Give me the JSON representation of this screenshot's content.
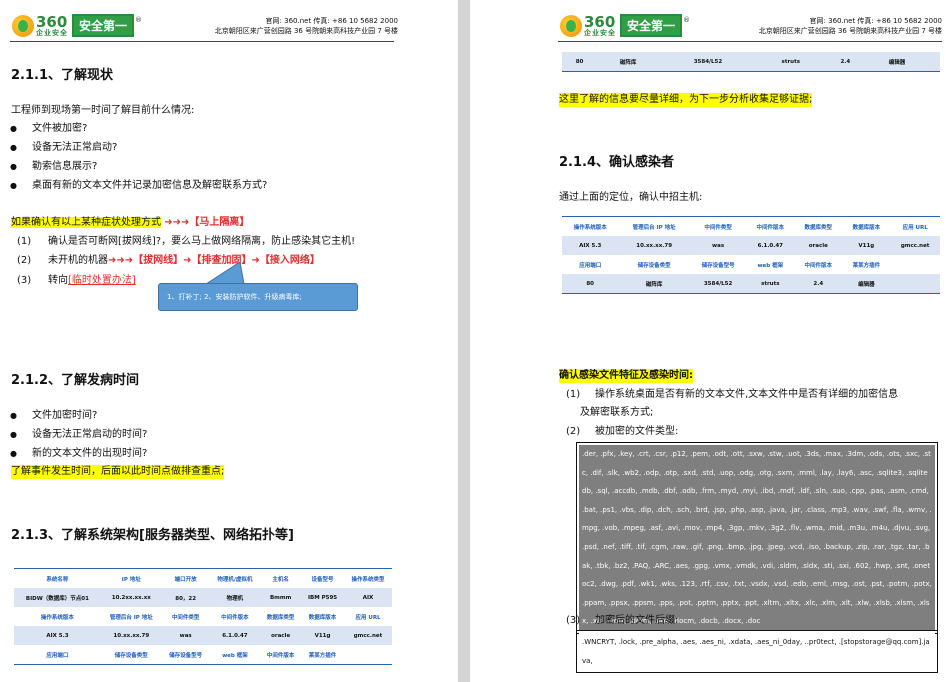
{
  "header": {
    "logo_number": "360",
    "logo_sub": "企业安全",
    "logo_box": "安全第一",
    "registered": "®",
    "line1": "官网: 360.net    传真: +86 10 5682 2000",
    "line2": "北京朝阳区来广营创园路 36 号院朝来高科技产业园 7 号楼"
  },
  "left": {
    "s211_title": "2.1.1、了解现状",
    "intro": "工程师到现场第一时间了解目前什么情况:",
    "bullets1": [
      "文件被加密?",
      "设备无法正常启动?",
      "勒索信息展示?",
      "桌面有新的文本文件并记录加密信息及解密联系方式?"
    ],
    "symptom_text": "如果确认有以上某种症状处理方式",
    "symptom_arrows": "➜➜➜",
    "symptom_action": "【马上隔离】",
    "item1_num": "(1)",
    "item1": "确认是否可断网[拔网线]?，要么马上做网络隔离，防止感染其它主机!",
    "item2_num": "(2)",
    "item2_text": "未开机的机器",
    "item2_red": "➜➜➜【拔网线】➜【排查加固】➜【接入网络】",
    "item3_num": "(3)",
    "item3_text": "转向",
    "item3_link": "[临时处置办法]",
    "callout": "1、打补丁; 2、安装防护软件、升级病毒库;",
    "s212_title": "2.1.2、了解发病时间",
    "bullets2": [
      "文件加密时间?",
      "设备无法正常启动的时间?",
      "新的文本文件的出现时间?"
    ],
    "s212_note": "了解事件发生时间，后面以此时间点做排查重点;",
    "s213_title": "2.1.3、了解系统架构[服务器类型、网络拓扑等]",
    "table": {
      "rows": [
        [
          "系统名称",
          "IP 地址",
          "端口开放",
          "物理机/虚拟机",
          "主机名",
          "设备型号",
          "操作系统类型"
        ],
        [
          "BIDW（数据库）节点01",
          "10.2xx.xx.xx",
          "80，22",
          "物理机",
          "Bmmm",
          "IBM P595",
          "AIX"
        ],
        [
          "操作系统版本",
          "管理后台 IP 地址",
          "中间件类型",
          "中间件版本",
          "数据库类型",
          "数据库版本",
          "应用 URL"
        ],
        [
          "AIX 5.3",
          "10.xx.xx.79",
          "was",
          "6.1.0.47",
          "oracle",
          "V11g",
          "gmcc.net"
        ],
        [
          "应用端口",
          "储存设备类型",
          "储存设备型号",
          "web 框架",
          "中间件版本",
          "莱某方插件",
          ""
        ]
      ]
    }
  },
  "right": {
    "top_row": [
      "80",
      "磁阵库",
      "3584/L52",
      "struts",
      "2.4",
      "编辑器"
    ],
    "note1": "这里了解的信息要尽量详细，为下一步分析收集足够证据;",
    "s214_title": "2.1.4、确认感染者",
    "s214_intro": "通过上面的定位，确认中招主机:",
    "table": {
      "rows": [
        [
          "操作系统版本",
          "管理后台 IP 地址",
          "中间件类型",
          "中间件版本",
          "数据库类型",
          "数据库版本",
          "应用 URL"
        ],
        [
          "AIX 5.3",
          "10.xx.xx.79",
          "was",
          "6.1.0.47",
          "oracle",
          "V11g",
          "gmcc.net"
        ],
        [
          "应用端口",
          "储存设备类型",
          "储存设备型号",
          "web 框架",
          "中间件版本",
          "莱某方插件",
          ""
        ],
        [
          "80",
          "磁阵库",
          "3584/L52",
          "struts",
          "2.4",
          "编辑器",
          ""
        ]
      ]
    },
    "confirm_title": "确认感染文件特征及感染时间:",
    "c1_num": "(1)",
    "c1_line1": "操作系统桌面是否有新的文本文件,文本文件中是否有详细的加密信息",
    "c1_line2": "及解密联系方式;",
    "c2_num": "(2)",
    "c2_text": "被加密的文件类型:",
    "file_types": ".der, .pfx, .key, .crt, .csr, .p12, .pem, .odt, .ott, .sxw, .stw, .uot, .3ds, .max, .3dm, .ods, .ots, .sxc, .stc, .dif, .slk, .wb2, .odp, .otp, .sxd, .std, .uop, .odg, .otg, .sxm, .mml, .lay, .lay6, .asc, .sqlite3, .sqlitedb, .sql, .accdb, .mdb, .dbf, .odb, .frm, .myd, .myi, .ibd, .mdf, .ldf, .sln, .suo, .cpp, .pas, .asm, .cmd, .bat, .ps1, .vbs, .dip, .dch, .sch, .brd, .jsp, .php, .asp, .java, .jar, .class, .mp3, .wav, .swf, .fla, .wmv, .mpg, .vob, .mpeg, .asf, .avi, .mov, .mp4, .3gp, .mkv, .3g2, .flv, .wma, .mid, .m3u, .m4u, .djvu, .svg, .psd, .nef, .tiff, .tif, .cgm, .raw, .gif, .png, .bmp, .jpg, .jpeg, .vcd, .iso, .backup, .zip, .rar, .tgz, .tar, .bak, .tbk, .bz2, .PAQ, .ARC, .aes, .gpg, .vmx, .vmdk, .vdi, .sldm, .sldx, .sti, .sxi, .602, .hwp, .snt, .onetoc2, .dwg, .pdf, .wk1, .wks, .123, .rtf, .csv, .txt, .vsdx, .vsd, .edb, .eml, .msg, .ost, .pst, .potm, .potx, .ppam, .ppsx, .ppsm, .pps, .pot, .pptm, .pptx, .ppt, .xltm, .xltx, .xlc, .xlm, .xlt, .xlw, .xlsb, .xlsm, .xlsx, .xls, .dotx, .dotm, .dot, .docm, .docb, .docx, .doc",
    "c3_num": "(3)",
    "c3_text": "加密后的文件后缀:",
    "suffixes": ".WNCRYT, .lock, .pre_alpha, .aes, .aes_ni, .xdata, .aes_ni_0day, ..pr0tect, .[stopstorage@qq.com].java,"
  }
}
